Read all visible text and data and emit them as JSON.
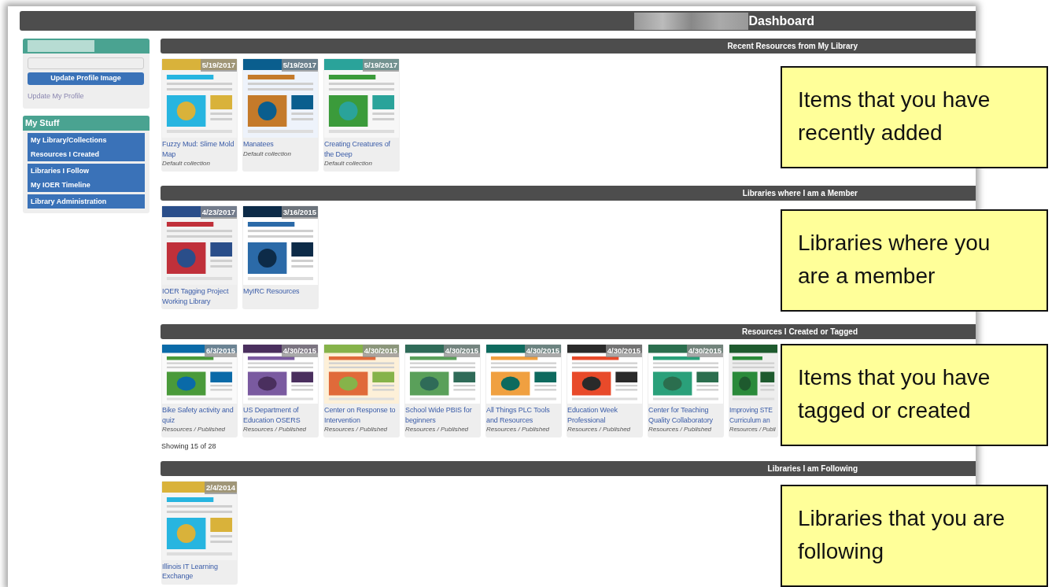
{
  "header": {
    "title": "Dashboard",
    "redacted_prefix": true
  },
  "sidebar": {
    "profile": {
      "name_redacted": true,
      "button": "Update Profile Image",
      "link": "Update My Profile"
    },
    "my_stuff": {
      "title": "My Stuff",
      "groups": [
        {
          "items": [
            "My Library/Collections",
            "Resources I Created"
          ]
        },
        {
          "items": [
            "Libraries I Follow",
            "My IOER Timeline"
          ]
        },
        {
          "items": [
            "Library Administration"
          ]
        }
      ]
    }
  },
  "sections": [
    {
      "title": "Recent Resources from My Library",
      "cards": [
        {
          "date": "5/19/2017",
          "title": "Fuzzy Mud: Slime Mold Map",
          "subtitle": "Default collection"
        },
        {
          "date": "5/19/2017",
          "title": "Manatees",
          "subtitle": "Default collection"
        },
        {
          "date": "5/19/2017",
          "title": "Creating Creatures of the Deep",
          "subtitle": "Default collection"
        }
      ]
    },
    {
      "title": "Libraries where I am a Member",
      "cards": [
        {
          "date": "4/23/2017",
          "title": "IOER Tagging Project Working Library"
        },
        {
          "date": "3/16/2015",
          "title": "MyIRC Resources"
        }
      ]
    },
    {
      "title": "Resources I Created or Tagged",
      "cards": [
        {
          "date": "6/3/2015",
          "title": "Bike Safety activity and quiz",
          "subtitle": "Resources / Published"
        },
        {
          "date": "4/30/2015",
          "title": "US Department of Education OSERS",
          "subtitle": "Resources / Published"
        },
        {
          "date": "4/30/2015",
          "title": "Center on Response to Intervention",
          "subtitle": "Resources / Published"
        },
        {
          "date": "4/30/2015",
          "title": "School Wide PBIS for beginners",
          "subtitle": "Resources / Published"
        },
        {
          "date": "4/30/2015",
          "title": "All Things PLC Tools and Resources",
          "subtitle": "Resources / Published"
        },
        {
          "date": "4/30/2015",
          "title": "Education Week Professional",
          "subtitle": "Resources / Published"
        },
        {
          "date": "4/30/2015",
          "title": "Center for Teaching Quality Collaboratory",
          "subtitle": "Resources / Published"
        },
        {
          "kind": "partial",
          "title": "Improving STE\nCurriculum an",
          "subtitle": "Resources / Publi"
        }
      ],
      "footer": "Showing 15 of 28"
    },
    {
      "title": "Libraries I am Following",
      "cards": [
        {
          "date": "2/4/2014",
          "title": "Illinois IT Learning Exchange"
        }
      ]
    }
  ],
  "callouts": [
    "Items that you have recently added",
    "Libraries where you are a member",
    "Items that you have tagged or created",
    "Libraries that you are following"
  ]
}
